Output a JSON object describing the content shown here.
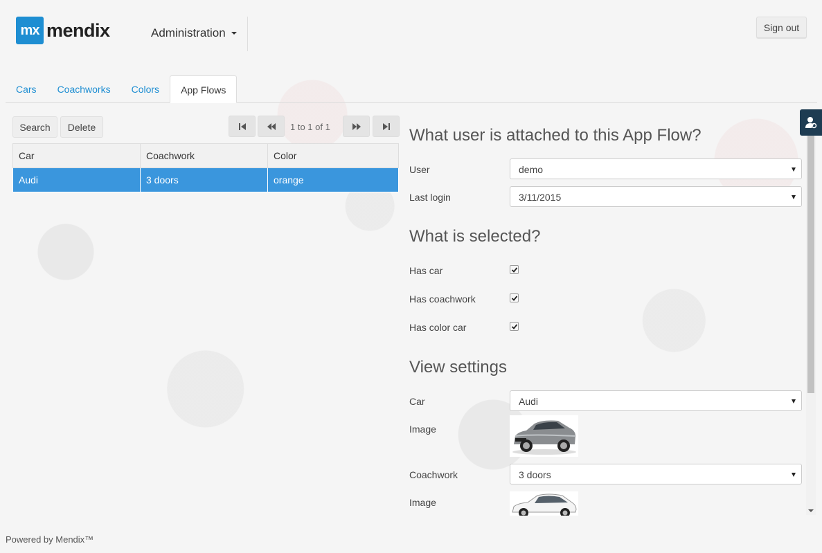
{
  "header": {
    "logo_mark": "mx",
    "logo_text": "mendix",
    "nav_menu": "Administration",
    "signout_label": "Sign out"
  },
  "tabs": [
    {
      "label": "Cars",
      "active": false
    },
    {
      "label": "Coachworks",
      "active": false
    },
    {
      "label": "Colors",
      "active": false
    },
    {
      "label": "App Flows",
      "active": true
    }
  ],
  "toolbar": {
    "search_label": "Search",
    "delete_label": "Delete",
    "pager_text": "1 to 1 of 1"
  },
  "grid": {
    "columns": [
      "Car",
      "Coachwork",
      "Color"
    ],
    "rows": [
      {
        "car": "Audi",
        "coachwork": "3 doors",
        "color": "orange",
        "selected": true
      }
    ]
  },
  "section_user": {
    "title": "What user is attached to this App Flow?",
    "user_label": "User",
    "user_value": "demo",
    "last_login_label": "Last login",
    "last_login_value": "3/11/2015"
  },
  "section_selected": {
    "title": "What is selected?",
    "has_car_label": "Has car",
    "has_car": true,
    "has_coachwork_label": "Has coachwork",
    "has_coachwork": true,
    "has_color_label": "Has color car",
    "has_color": true
  },
  "section_view": {
    "title": "View settings",
    "car_label": "Car",
    "car_value": "Audi",
    "image1_label": "Image",
    "coachwork_label": "Coachwork",
    "coachwork_value": "3 doors",
    "image2_label": "Image"
  },
  "footer": {
    "text": "Powered by Mendix™"
  },
  "colors": {
    "accent": "#1e8ed2",
    "selected_row": "#3a96dd",
    "side_tab": "#1e3c52"
  },
  "icons": {
    "first_page": "first-page-icon",
    "prev_page": "previous-page-icon",
    "next_page": "next-page-icon",
    "last_page": "last-page-icon",
    "user_settings": "user-settings-icon"
  }
}
